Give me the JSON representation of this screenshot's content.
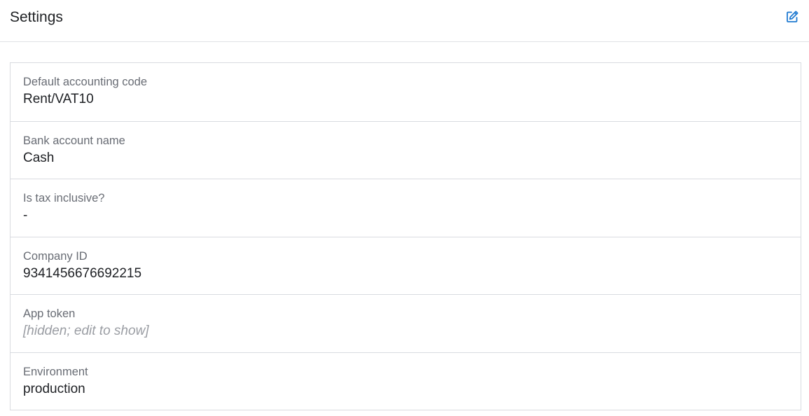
{
  "header": {
    "title": "Settings",
    "edit_icon": "edit-icon",
    "accent_color": "#1f7ad1"
  },
  "fields": [
    {
      "label": "Default accounting code",
      "value": "Rent/VAT10"
    },
    {
      "label": "Bank account name",
      "value": "Cash"
    },
    {
      "label": "Is tax inclusive?",
      "value": "-"
    },
    {
      "label": "Company ID",
      "value": "9341456676692215"
    },
    {
      "label": "App token",
      "value": "[hidden; edit to show]"
    },
    {
      "label": "Environment",
      "value": "production"
    }
  ]
}
